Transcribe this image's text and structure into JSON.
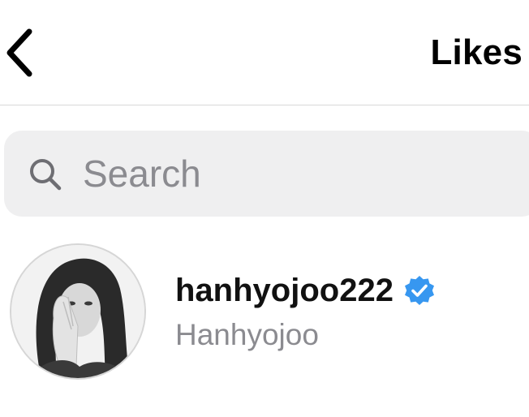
{
  "header": {
    "title": "Likes",
    "back_icon": "chevron-left-icon"
  },
  "search": {
    "placeholder": "Search",
    "value": "",
    "icon": "search-icon"
  },
  "likes": [
    {
      "username": "hanhyojoo222",
      "full_name": "Hanhyojoo",
      "verified": true,
      "verified_icon": "verified-badge-icon"
    }
  ],
  "colors": {
    "background": "#ffffff",
    "search_fill": "#efeff0",
    "placeholder": "#8b8b90",
    "secondary_text": "#8b8b90",
    "verified_blue": "#3797f0",
    "divider": "#d9d9d9"
  }
}
